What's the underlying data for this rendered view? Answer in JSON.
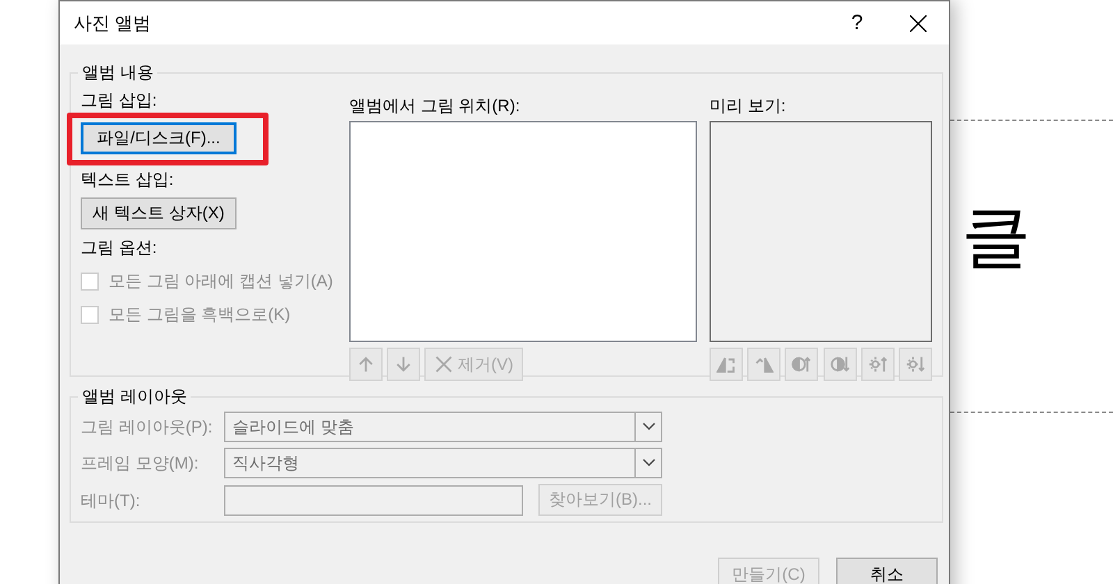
{
  "window": {
    "title": "사진 앨범",
    "help": "?"
  },
  "album_content": {
    "legend": "앨범 내용",
    "insert_picture": {
      "label": "그림 삽입:",
      "button": "파일/디스크(F)...",
      "focused": true,
      "highlighted": true
    },
    "insert_text": {
      "label": "텍스트 삽입:",
      "button": "새 텍스트 상자(X)"
    },
    "picture_options": {
      "label": "그림 옵션:",
      "options": [
        {
          "label": "모든 그림 아래에 캡션 넣기(A)",
          "checked": false,
          "disabled": true
        },
        {
          "label": "모든 그림을 흑백으로(K)",
          "checked": false,
          "disabled": true
        }
      ]
    },
    "pictures_in_album": {
      "label": "앨범에서 그림 위치(R):",
      "buttons": [
        {
          "kind": "up",
          "disabled": true
        },
        {
          "kind": "down",
          "disabled": true
        },
        {
          "kind": "remove",
          "label": "제거(V)",
          "disabled": true
        }
      ]
    },
    "preview": {
      "label": "미리 보기:",
      "buttons": [
        {
          "kind": "rotate-left",
          "disabled": true
        },
        {
          "kind": "rotate-right",
          "disabled": true
        },
        {
          "kind": "contrast-up",
          "disabled": true
        },
        {
          "kind": "contrast-down",
          "disabled": true
        },
        {
          "kind": "brightness-up",
          "disabled": true
        },
        {
          "kind": "brightness-down",
          "disabled": true
        }
      ]
    }
  },
  "album_layout": {
    "legend": "앨범 레이아웃",
    "disabled": true,
    "fields": [
      {
        "kind": "select",
        "label": "그림 레이아웃(P):",
        "value": "슬라이드에 맞춤"
      },
      {
        "kind": "select",
        "label": "프레임 모양(M):",
        "value": "직사각형"
      },
      {
        "kind": "text",
        "label": "테마(T):",
        "button": "찾아보기(B)..."
      }
    ]
  },
  "footer": {
    "buttons": [
      {
        "label": "만들기(C)",
        "disabled": true
      },
      {
        "label": "취소",
        "disabled": false
      }
    ]
  },
  "slide": {
    "text": "클"
  }
}
